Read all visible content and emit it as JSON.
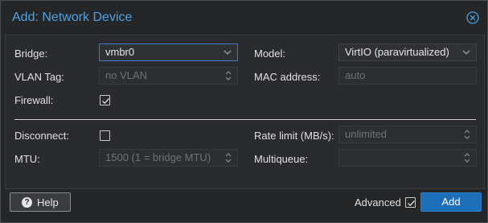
{
  "dialog": {
    "title": "Add: Network Device"
  },
  "left": {
    "bridge_label": "Bridge:",
    "bridge_value": "vmbr0",
    "vlan_label": "VLAN Tag:",
    "vlan_placeholder": "no VLAN",
    "firewall_label": "Firewall:",
    "firewall_checked": true,
    "disconnect_label": "Disconnect:",
    "disconnect_checked": false,
    "mtu_label": "MTU:",
    "mtu_placeholder": "1500 (1 = bridge MTU)"
  },
  "right": {
    "model_label": "Model:",
    "model_value": "VirtIO (paravirtualized)",
    "mac_label": "MAC address:",
    "mac_placeholder": "auto",
    "rate_label": "Rate limit (MB/s):",
    "rate_placeholder": "unlimited",
    "multiqueue_label": "Multiqueue:",
    "multiqueue_value": ""
  },
  "footer": {
    "help_label": "Help",
    "advanced_label": "Advanced",
    "advanced_checked": true,
    "add_label": "Add"
  },
  "colors": {
    "accent": "#4ea1e5",
    "primary_button": "#1f6fb8",
    "focus_border": "#3d7cc9"
  }
}
